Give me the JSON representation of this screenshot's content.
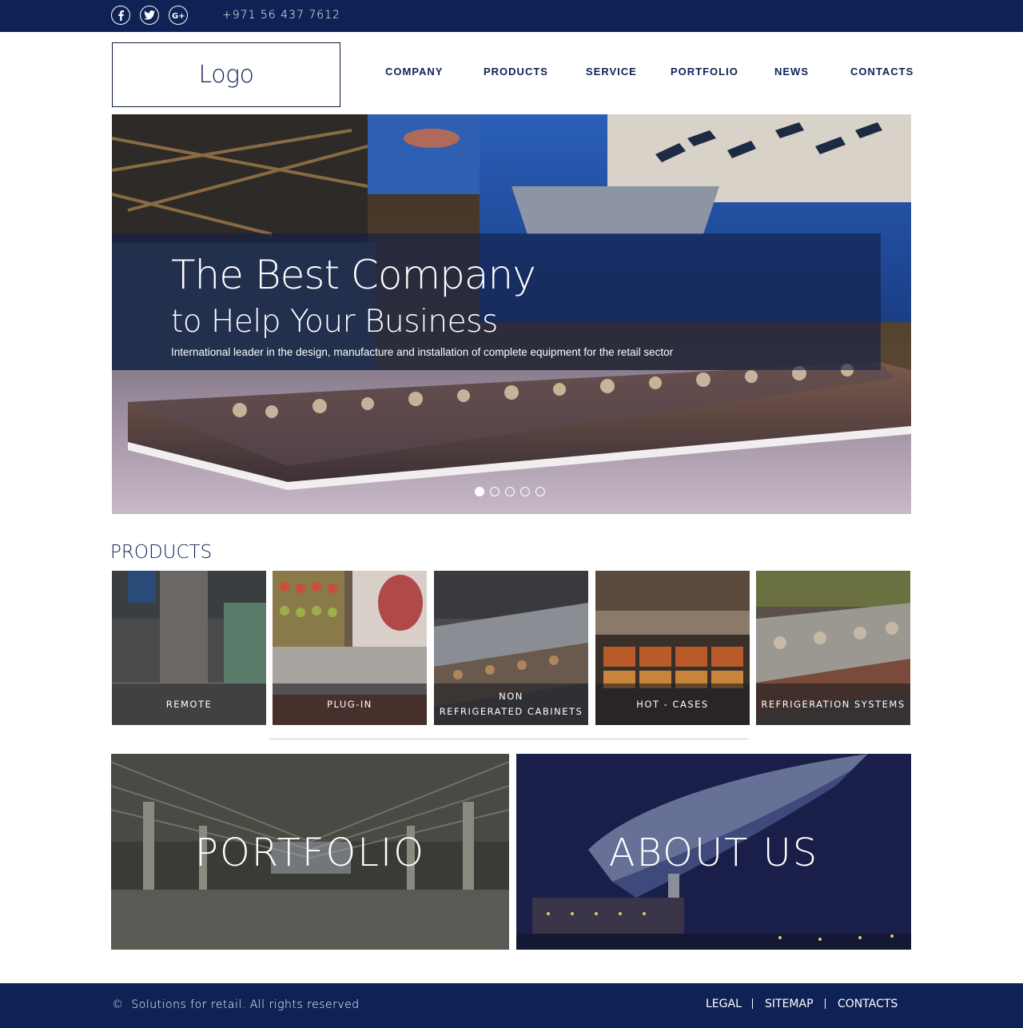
{
  "topbar": {
    "social": [
      {
        "name": "facebook",
        "glyph": "f"
      },
      {
        "name": "twitter",
        "glyph": "t"
      },
      {
        "name": "google-plus",
        "glyph": "G+"
      }
    ],
    "phone": "+971 56 437 7612"
  },
  "header": {
    "logo": "Logo",
    "nav": [
      "COMPANY",
      "PRODUCTS",
      "SERVICE",
      "PORTFOLIO",
      "NEWS",
      "CONTACTS"
    ]
  },
  "hero": {
    "title": "The Best Company",
    "subtitle": "to Help Your Business",
    "description": "International leader in the design, manufacture and installation of complete equipment for the retail sector",
    "slides": 5,
    "active_slide": 1
  },
  "products": {
    "title": "PRODUCTS",
    "items": [
      {
        "label": "REMOTE"
      },
      {
        "label": "PLUG-IN"
      },
      {
        "label": "NON\nREFRIGERATED CABINETS"
      },
      {
        "label": "HOT - CASES"
      },
      {
        "label": "REFRIGERATION SYSTEMS"
      }
    ]
  },
  "features": {
    "portfolio": "PORTFOLIO",
    "about": "ABOUT US"
  },
  "footer": {
    "copyright_symbol": "©",
    "copyright": "Solutions for retail. All rights reserved",
    "links": [
      "LEGAL",
      "SITEMAP",
      "CONTACTS"
    ]
  },
  "colors": {
    "brand_navy": "#0e2256",
    "white": "#ffffff"
  }
}
